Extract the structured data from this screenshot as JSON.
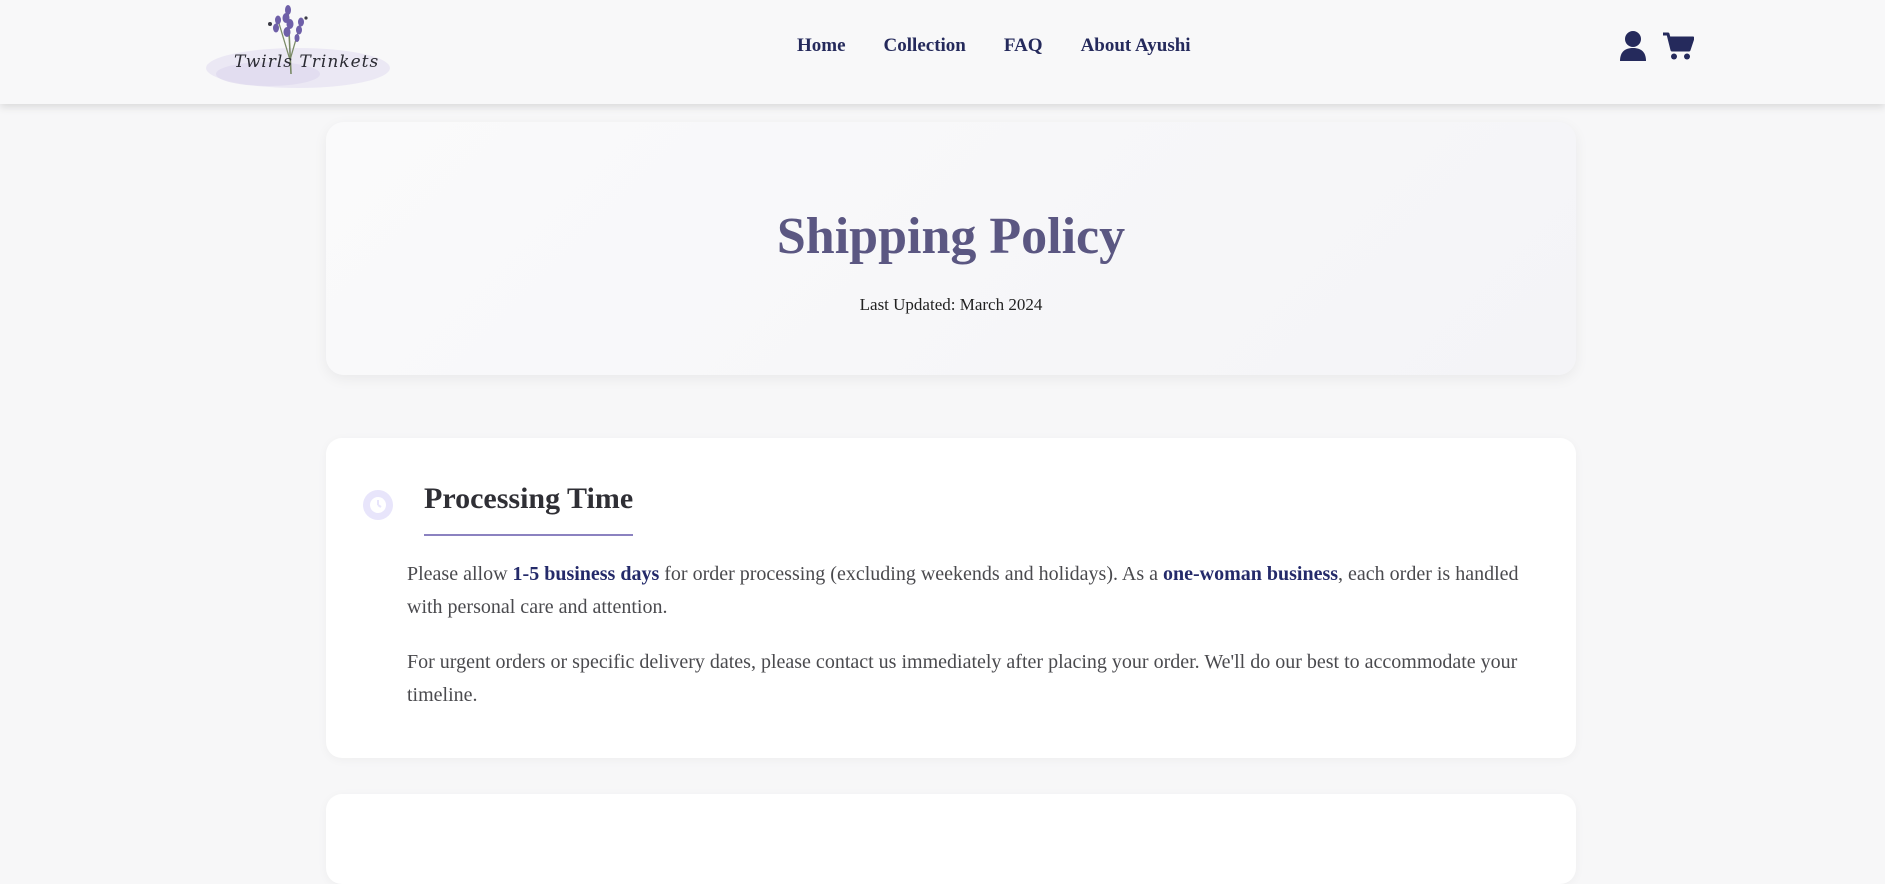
{
  "brand": {
    "logo_text": "Twirls Trinkets"
  },
  "nav": {
    "links": [
      "Home",
      "Collection",
      "FAQ",
      "About Ayushi"
    ],
    "icons": [
      "user-icon",
      "cart-icon"
    ]
  },
  "hero": {
    "title": "Shipping Policy",
    "updated": "Last Updated: March 2024"
  },
  "sections": [
    {
      "icon": "clock-icon",
      "title": "Processing Time",
      "paragraph1": {
        "t1": "Please allow ",
        "b1": "1-5 business days",
        "t2": " for order processing (excluding weekends and holidays). As a ",
        "b2": "one-woman business",
        "t3": ", each order is handled with personal care and attention."
      },
      "paragraph2": "For urgent orders or specific delivery dates, please contact us immediately after placing your order. We'll do our best to accommodate your timeline."
    }
  ],
  "colors": {
    "nav_text": "#252a5c",
    "hero_title": "#5b5782",
    "highlight": "#242a6a",
    "underline": "#8b82c0",
    "icon_bg": "#e8e5fb"
  }
}
